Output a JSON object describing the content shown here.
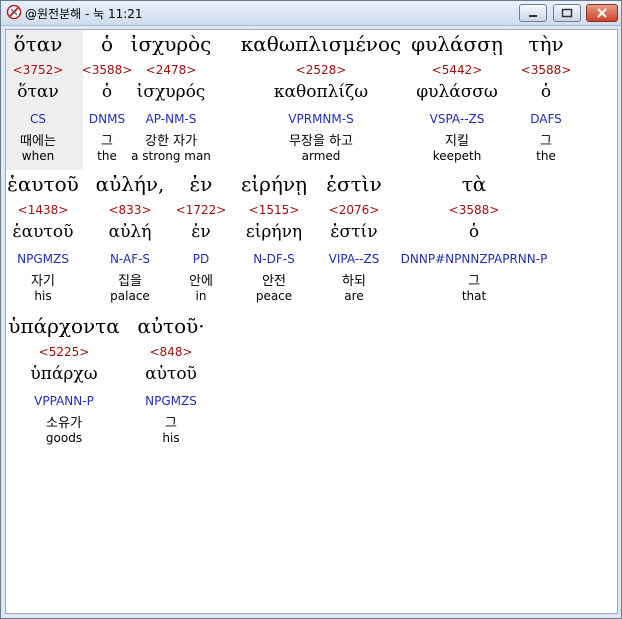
{
  "window": {
    "title": "@원전분해 - 눅 11:21",
    "buttons": [
      "minimize",
      "maximize",
      "close"
    ]
  },
  "rows": [
    {
      "words": [
        {
          "greek": "ὅταν",
          "strong": "<3752>",
          "lemma": "ὅταν",
          "parse": "CS",
          "korean": "때에는",
          "english": "when"
        },
        {
          "greek": "ὁ",
          "strong": "<3588>",
          "lemma": "ὁ",
          "parse": "DNMS",
          "korean": "그",
          "english": "the"
        },
        {
          "greek": "ἰσχυρὸς",
          "strong": "<2478>",
          "lemma": "ἰσχυρός",
          "parse": "AP-NM-S",
          "korean": "강한 자가",
          "english": "a strong man"
        },
        {
          "greek": "καθωπλισμένος",
          "strong": "<2528>",
          "lemma": "καθοπλίζω",
          "parse": "VPRMNM-S",
          "korean": "무장을 하고",
          "english": "armed"
        },
        {
          "greek": "φυλάσσῃ",
          "strong": "<5442>",
          "lemma": "φυλάσσω",
          "parse": "VSPA--ZS",
          "korean": "지킬",
          "english": "keepeth"
        },
        {
          "greek": "τὴν",
          "strong": "<3588>",
          "lemma": "ὁ",
          "parse": "DAFS",
          "korean": "그",
          "english": "the"
        }
      ]
    },
    {
      "words": [
        {
          "greek": "ἑαυτοῦ",
          "strong": "<1438>",
          "lemma": "ἑαυτοῦ",
          "parse": "NPGMZS",
          "korean": "자기",
          "english": "his"
        },
        {
          "greek": "αὐλήν,",
          "strong": "<833>",
          "lemma": "αὐλή",
          "parse": "N-AF-S",
          "korean": "집을",
          "english": "palace"
        },
        {
          "greek": "ἐν",
          "strong": "<1722>",
          "lemma": "ἐν",
          "parse": "PD",
          "korean": "안에",
          "english": "in"
        },
        {
          "greek": "εἰρήνῃ",
          "strong": "<1515>",
          "lemma": "εἰρήνη",
          "parse": "N-DF-S",
          "korean": "안전",
          "english": "peace"
        },
        {
          "greek": "ἐστὶν",
          "strong": "<2076>",
          "lemma": "ἐστίν",
          "parse": "VIPA--ZS",
          "korean": "하되",
          "english": "are"
        },
        {
          "greek": "τὰ",
          "strong": "<3588>",
          "lemma": "ὁ",
          "parse": "DNNP#NPNNZPAPRNN-P",
          "korean": "그",
          "english": "that"
        }
      ]
    },
    {
      "words": [
        {
          "greek": "ὑπάρχοντα",
          "strong": "<5225>",
          "lemma": "ὑπάρχω",
          "parse": "VPPANN-P",
          "korean": "소유가",
          "english": "goods"
        },
        {
          "greek": "αὐτοῦ·",
          "strong": "<848>",
          "lemma": "αὑτοῦ",
          "parse": "NPGMZS",
          "korean": "그",
          "english": "his"
        }
      ]
    }
  ]
}
